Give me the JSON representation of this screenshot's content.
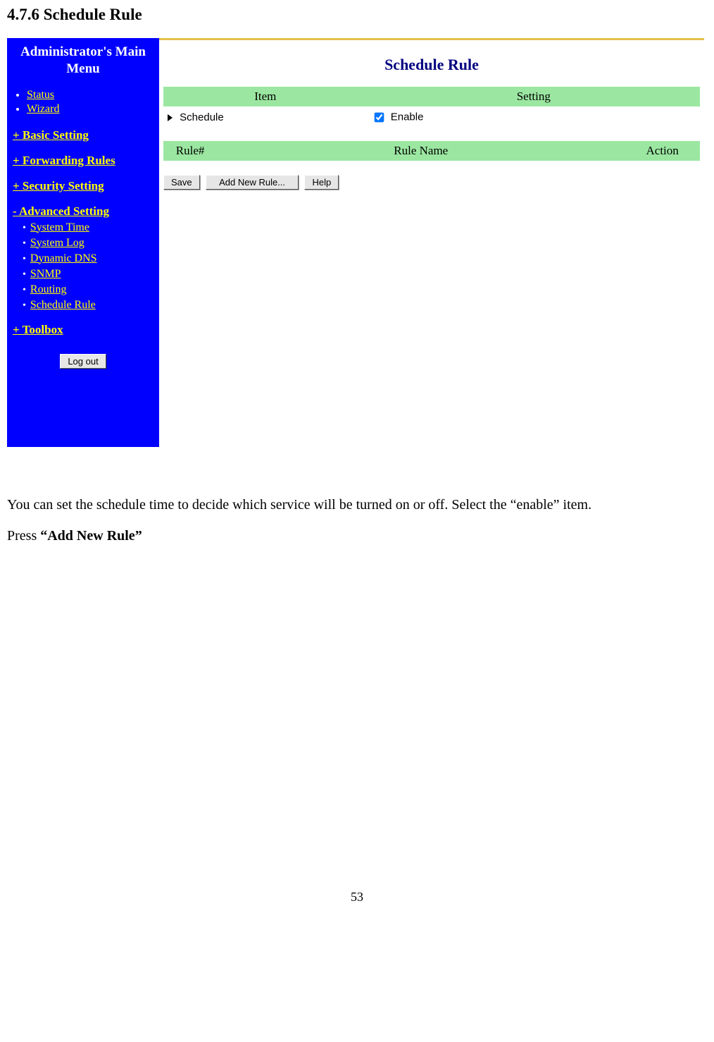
{
  "doc": {
    "heading": "4.7.6 Schedule Rule",
    "paragraph1_pre": "You can set the schedule time to decide which service will be turned on or off. Select the “enable” item.",
    "paragraph2_pre": "Press ",
    "paragraph2_bold": "“Add New Rule”",
    "page_number": "53"
  },
  "sidebar": {
    "title": "Administrator's Main Menu",
    "top_items": [
      "Status",
      "Wizard"
    ],
    "sections": {
      "basic": "+ Basic Setting",
      "forwarding": "+ Forwarding Rules",
      "security": "+ Security Setting",
      "advanced": "- Advanced Setting",
      "toolbox": "+ Toolbox"
    },
    "advanced_items": [
      "System Time",
      "System Log",
      "Dynamic DNS",
      "SNMP",
      "Routing",
      "Schedule Rule"
    ],
    "logout_label": "Log out"
  },
  "content": {
    "title": "Schedule Rule",
    "table1": {
      "header_item": "Item",
      "header_setting": "Setting",
      "row_schedule_label": "Schedule",
      "row_schedule_enable_label": "Enable",
      "row_schedule_enable_checked": true
    },
    "table2": {
      "header_rule_no": "Rule#",
      "header_rule_name": "Rule Name",
      "header_action": "Action"
    },
    "buttons": {
      "save": "Save",
      "add_new_rule": "Add New Rule...",
      "help": "Help"
    }
  }
}
